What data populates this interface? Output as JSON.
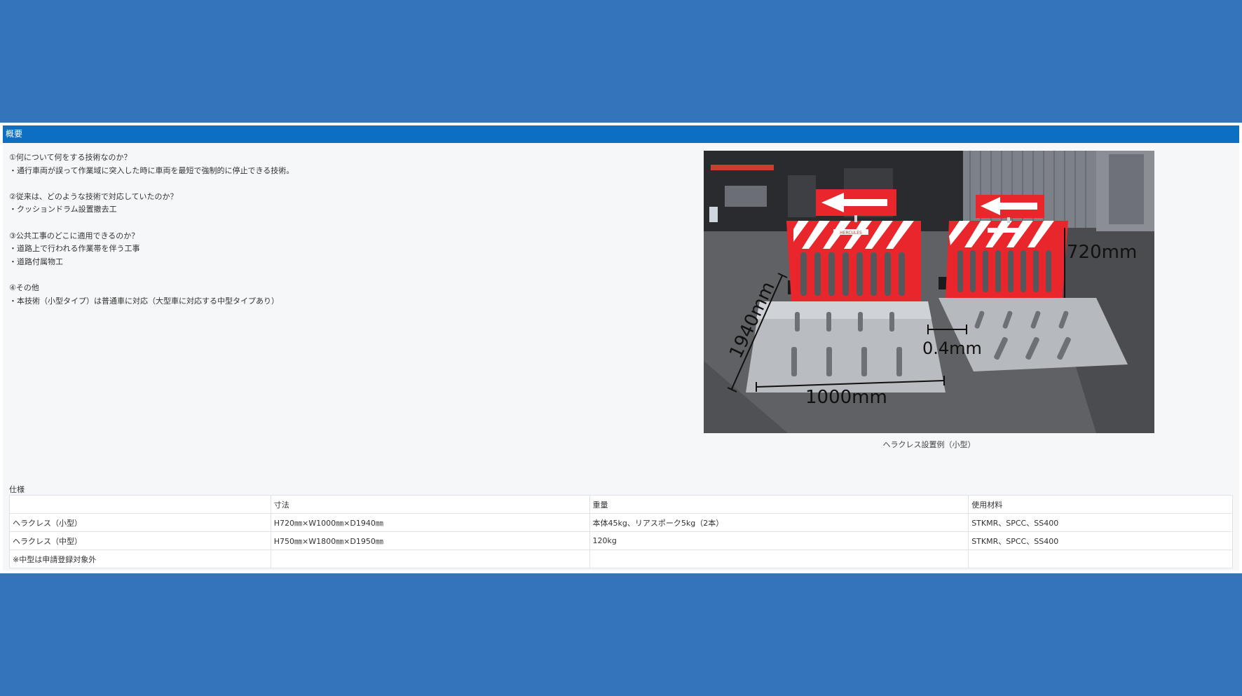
{
  "section": {
    "title": "概要"
  },
  "description": {
    "lines": [
      "①何について何をする技術なのか？",
      "・通行車両が誤って作業域に突入した時に車両を最短で強制的に停止できる技術。",
      "",
      "②従来は、どのような技術で対応していたのか？",
      "・クッションドラム設置撤去工",
      "",
      "③公共工事のどこに適用できるのか？",
      "・道路上で行われる作業帯を伴う工事",
      "・道路付属物工",
      "",
      "④その他",
      "・本技術（小型タイプ）は普通車に対応（大型車に対応する中型タイプあり）"
    ]
  },
  "photo": {
    "caption": "ヘラクレス設置例（小型）",
    "labels": {
      "height": "720mm",
      "depth": "1940mm",
      "width": "1000mm",
      "gap": "0.4mm",
      "brand": "HERCULES"
    }
  },
  "spec": {
    "label": "仕様",
    "header": [
      "",
      "寸法",
      "重量",
      "使用材料"
    ],
    "rows": [
      [
        "ヘラクレス（小型）",
        "H720㎜×W1000㎜×D1940㎜",
        "本体45kg、リアスポーク5kg（2本）",
        "STKMR、SPCC、SS400"
      ],
      [
        "ヘラクレス（中型）",
        "H750㎜×W1800㎜×D1950㎜",
        "120kg",
        "STKMR、SPCC、SS400"
      ],
      [
        "※中型は申請登録対象外",
        "",
        "",
        ""
      ]
    ]
  },
  "colors": {
    "background": "#3374bb",
    "header": "#0c6fc2",
    "panel": "#f5f7f9",
    "barrier": "#e8262b"
  }
}
